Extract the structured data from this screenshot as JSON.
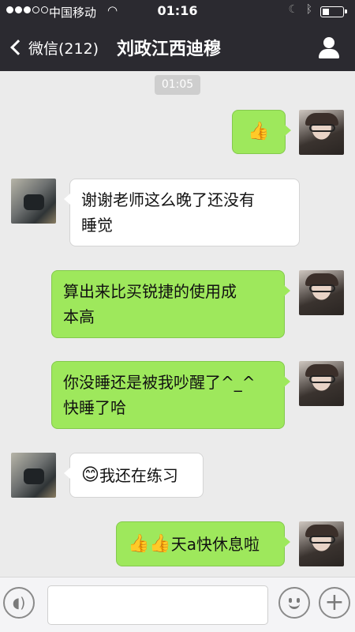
{
  "status_bar": {
    "carrier": "中国移动",
    "time": "01:16"
  },
  "nav": {
    "back_label": "微信(212)",
    "title": "刘政江西迪穆"
  },
  "chat": {
    "timestamp": "01:05",
    "messages": [
      {
        "sender": "me",
        "text": "",
        "emoji": "👍"
      },
      {
        "sender": "other",
        "text": "谢谢老师这么晚了还没有\n睡觉"
      },
      {
        "sender": "me",
        "text": "算出来比买锐捷的使用成\n本高"
      },
      {
        "sender": "me",
        "text": "你没睡还是被我吵醒了^_^\n快睡了哈"
      },
      {
        "sender": "other",
        "text": "我还在练习",
        "emoji": "😊"
      },
      {
        "sender": "me",
        "text": "天a快休息啦",
        "emoji": "👍👍"
      }
    ]
  },
  "input_bar": {
    "placeholder": ""
  },
  "colors": {
    "nav_bg": "#2b2a30",
    "chat_bg": "#ebebeb",
    "my_bubble": "#9ee85c",
    "other_bubble": "#ffffff"
  },
  "icons": [
    "signal-dots",
    "wifi-icon",
    "moon-icon",
    "bluetooth-icon",
    "battery-icon",
    "back-chevron-icon",
    "profile-icon",
    "voice-icon",
    "emoji-face-icon",
    "plus-icon"
  ]
}
